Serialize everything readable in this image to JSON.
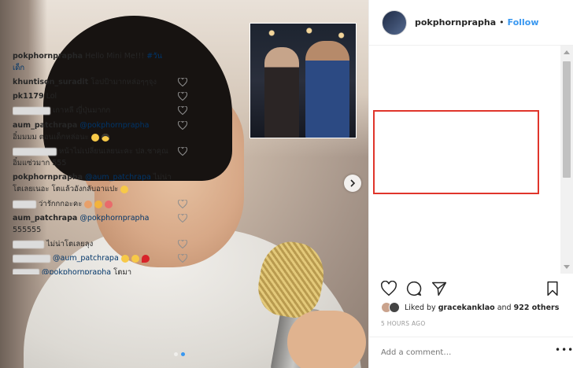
{
  "header": {
    "username": "pokphornprapha",
    "separator": "•",
    "follow_label": "Follow"
  },
  "comments": [
    {
      "user": "pokphornprapha",
      "text": "Hello Mini Me!!!",
      "tag": "#วันเด็ก",
      "has_heart": false
    },
    {
      "user": "khuntison_suradit",
      "text": "โอปป้ามากหล่อๆๆจุง",
      "has_heart": true
    },
    {
      "user": "pk1179",
      "text": "Lol",
      "has_heart": true
    },
    {
      "user": "",
      "text": "เกาหลี ญี่ปุ่นมากก",
      "blurred_user": true,
      "has_heart": true
    },
    {
      "user": "aum_patchrapa",
      "mention": "@pokphornprapha",
      "text": "อิ๋มมมม ตอนเด็กหล่อนะ",
      "emoji": "smile-sunglasses",
      "has_heart": true
    },
    {
      "user": "",
      "text": "หน้าไม่เปลี่ยนเลยนะคะ ปล.ชาคุณอิ๋มแซ่วมาก 555",
      "blurred_user": true,
      "has_heart": true
    },
    {
      "user": "pokphornprapha",
      "mention": "@aum_patchrapa",
      "text": "ไม่น่าโตเลยเนอะ โตแล้วอังกลับอาแปะ",
      "emoji": "confused",
      "has_heart": true
    },
    {
      "user": "",
      "text": "ว่ารักกกอะคะ",
      "blurred_user": true,
      "emoji": "hearts",
      "has_heart": true
    },
    {
      "user": "aum_patchrapa",
      "mention": "@pokphornprapha",
      "text": "555555",
      "has_heart": true
    },
    {
      "user": "",
      "text": "ไม่น่าโตเลยลุง",
      "blurred_user": true,
      "has_heart": true
    },
    {
      "user": "",
      "mention": "@aum_patchrapa",
      "text": "",
      "blurred_user": true,
      "emoji": "laugh-heart",
      "has_heart": true
    },
    {
      "user": "",
      "mention": "@pokphornprapha",
      "text": "โตมา",
      "blurred_user": true,
      "has_heart": false
    }
  ],
  "likes": {
    "prefix": "Liked by",
    "user": "gracekanklao",
    "conjunction": "and",
    "others": "922 others"
  },
  "timestamp": "5 HOURS AGO",
  "add_comment": {
    "placeholder": "Add a comment…",
    "more_label": "•••"
  },
  "carousel": {
    "current_index": 1,
    "total": 2
  },
  "colors": {
    "link_blue": "#3897f0",
    "mention_blue": "#003569",
    "highlight_red": "#e0352b"
  }
}
